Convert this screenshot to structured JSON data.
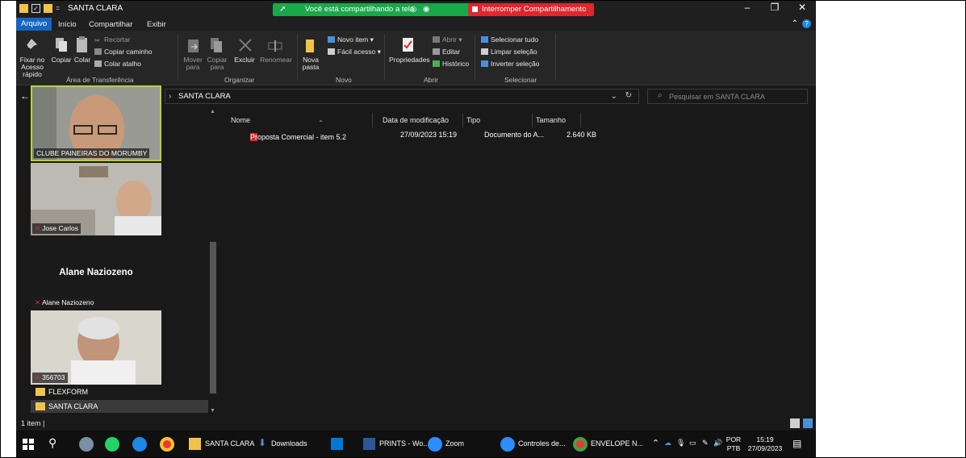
{
  "window": {
    "title": "SANTA CLARA",
    "qa_dropdown": "=",
    "controls": {
      "minimize": "–",
      "maximize": "❐",
      "close": "✕"
    }
  },
  "share": {
    "banner_text": "Você está compartilhando a tela",
    "stop_label": "Interromper Compartilhamento"
  },
  "menu": {
    "arquivo": "Arquivo",
    "inicio": "Início",
    "compartilhar": "Compartilhar",
    "exibir": "Exibir"
  },
  "ribbon": {
    "fixar_line1": "Fixar no",
    "fixar_line2": "Acesso rápido",
    "copiar": "Copiar",
    "colar": "Colar",
    "recortar": "Recortar",
    "copiar_caminho": "Copiar caminho",
    "colar_atalho": "Colar atalho",
    "group_transfer": "Área de Transferência",
    "mover_line1": "Mover",
    "mover_line2": "para",
    "copiar_para_line1": "Copiar",
    "copiar_para_line2": "para",
    "excluir": "Excluir",
    "renomear": "Renomear",
    "group_organizar": "Organizar",
    "nova_pasta_line1": "Nova",
    "nova_pasta_line2": "pasta",
    "novo_item": "Novo item ▾",
    "facil_acesso": "Fácil acesso ▾",
    "group_novo": "Novo",
    "propriedades": "Propriedades",
    "abrir": "Abrir ▾",
    "editar": "Editar",
    "historico": "Histórico",
    "group_abrir": "Abrir",
    "selecionar_tudo": "Selecionar tudo",
    "limpar_selecao": "Limpar seleção",
    "inverter_selecao": "Inverter seleção",
    "group_selecionar": "Selecionar"
  },
  "address": {
    "path": "SANTA CLARA",
    "search_placeholder": "Pesquisar em SANTA CLARA"
  },
  "participants": [
    {
      "name": "CLUBE PAINEIRAS DO MORUMBY"
    },
    {
      "name": "Jose Carlos"
    },
    {
      "name": "Alane Naziozeno",
      "big_name": "Alane Naziozeno"
    },
    {
      "name": "356703"
    }
  ],
  "nav_items": [
    {
      "label": "FLEXFORM"
    },
    {
      "label": "SANTA CLARA"
    }
  ],
  "columns": {
    "name": "Nome",
    "date": "Data de modificação",
    "type": "Tipo",
    "size": "Tamanho"
  },
  "files": [
    {
      "name": "Proposta Comercial - item 5.2",
      "date": "27/09/2023 15:19",
      "type": "Documento do A...",
      "size": "2.640 KB"
    }
  ],
  "status": {
    "count": "1 item  |"
  },
  "taskbar": {
    "apps": {
      "explorer": "SANTA CLARA",
      "downloads": "Downloads",
      "word": "PRINTS - Wo...",
      "zoom": "Zoom",
      "zoom_controls": "Controles de...",
      "chrome": "ENVELOPE N..."
    },
    "lang_line1": "POR",
    "lang_line2": "PTB",
    "time": "15:19",
    "date": "27/09/2023"
  },
  "colors": {
    "accent": "#1565c0",
    "share_green": "#1aa84a",
    "stop_red": "#e0262e",
    "folder": "#f0c44c",
    "speaker_border": "#b5d334"
  }
}
